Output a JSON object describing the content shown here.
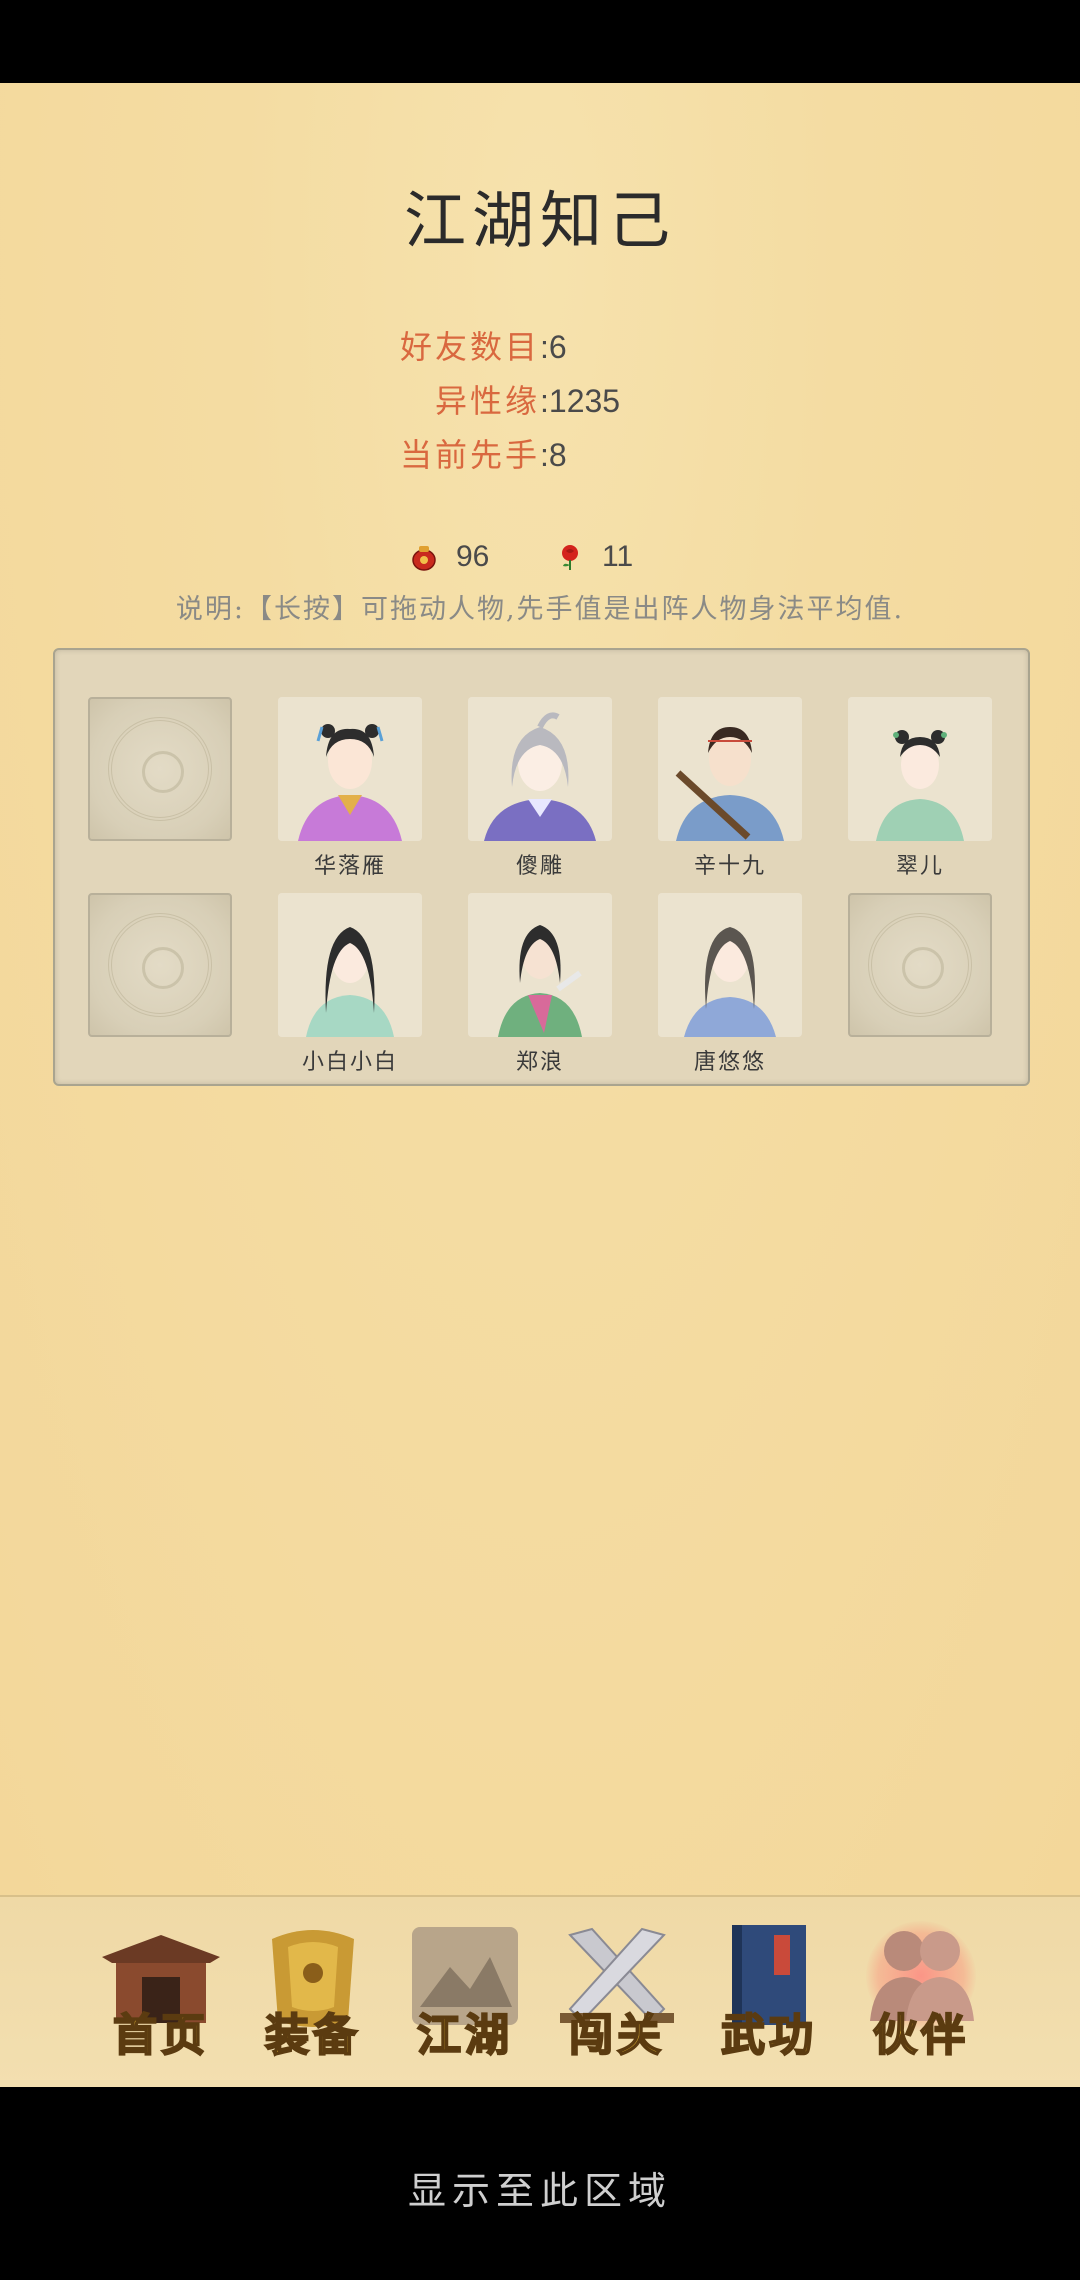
{
  "title": "江湖知己",
  "stats": [
    {
      "label": "好友数目",
      "value": "6"
    },
    {
      "label": "异性缘",
      "value": "1235"
    },
    {
      "label": "当前先手",
      "value": "8"
    }
  ],
  "resources": {
    "pouch": {
      "icon": "red-pouch-icon",
      "value": "96"
    },
    "rose": {
      "icon": "rose-icon",
      "value": "11"
    }
  },
  "note": "说明:【长按】可拖动人物,先手值是出阵人物身法平均值.",
  "slots_row1": [
    {
      "empty": true,
      "name": ""
    },
    {
      "empty": false,
      "name": "华落雁"
    },
    {
      "empty": false,
      "name": "傻雕"
    },
    {
      "empty": false,
      "name": "辛十九"
    },
    {
      "empty": false,
      "name": "翠儿"
    }
  ],
  "slots_row2": [
    {
      "empty": true,
      "name": ""
    },
    {
      "empty": false,
      "name": "小白小白"
    },
    {
      "empty": false,
      "name": "郑浪"
    },
    {
      "empty": false,
      "name": "唐悠悠"
    },
    {
      "empty": true,
      "name": ""
    }
  ],
  "nav": [
    {
      "label": "首页",
      "icon": "temple-icon",
      "active": false
    },
    {
      "label": "装备",
      "icon": "armor-icon",
      "active": false
    },
    {
      "label": "江湖",
      "icon": "scroll-map-icon",
      "active": false
    },
    {
      "label": "闯关",
      "icon": "crossed-swords-icon",
      "active": false
    },
    {
      "label": "武功",
      "icon": "book-icon",
      "active": false
    },
    {
      "label": "伙伴",
      "icon": "companions-icon",
      "active": true
    }
  ],
  "bottom_text": "显示至此区域",
  "colors": {
    "accent_label": "#d9683f",
    "value_text": "#4a4a4a",
    "nav_gold": "#e2b534"
  }
}
